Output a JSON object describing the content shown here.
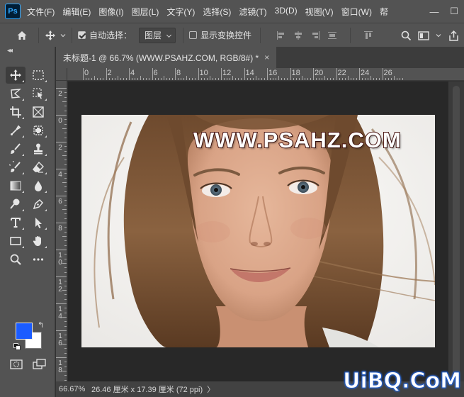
{
  "app": {
    "logo_text": "Ps"
  },
  "menu": {
    "items": [
      "文件(F)",
      "编辑(E)",
      "图像(I)",
      "图层(L)",
      "文字(Y)",
      "选择(S)",
      "滤镜(T)",
      "3D(D)",
      "视图(V)",
      "窗口(W)",
      "帮"
    ]
  },
  "window_controls": {
    "minimize": "—",
    "maximize": "☐"
  },
  "options": {
    "auto_select_label": "自动选择：",
    "auto_select_checked": true,
    "layer_select_value": "图层",
    "show_transform_label": "显示变换控件",
    "show_transform_checked": false
  },
  "document": {
    "tab_title": "未标题-1 @ 66.7% (WWW.PSAHZ.COM, RGB/8#) *",
    "tab_close": "×"
  },
  "rulers": {
    "horizontal": [
      "0",
      "2",
      "4",
      "6",
      "8",
      "10",
      "12",
      "14",
      "16",
      "18",
      "20",
      "22",
      "24",
      "26"
    ],
    "vertical": [
      "2",
      "0",
      "2",
      "4",
      "6",
      "8",
      "1 0",
      "1 2",
      "1 4",
      "1 6",
      "1 8"
    ]
  },
  "canvas": {
    "watermark_text": "WWW.PSAHZ.COM",
    "colors": {
      "hair": "#7a5436",
      "skin": "#d9a98c",
      "background": "#f4f3f1",
      "watermark_stroke": "#4a1410"
    }
  },
  "tools": {
    "foreground_color": "#1b5cff",
    "background_color": "#ffffff"
  },
  "status": {
    "zoom": "66.67%",
    "doc_size": "26.46 厘米 x 17.39 厘米 (72 ppi)",
    "arrow": "〉"
  },
  "site_logo": "UiBQ.CoM"
}
